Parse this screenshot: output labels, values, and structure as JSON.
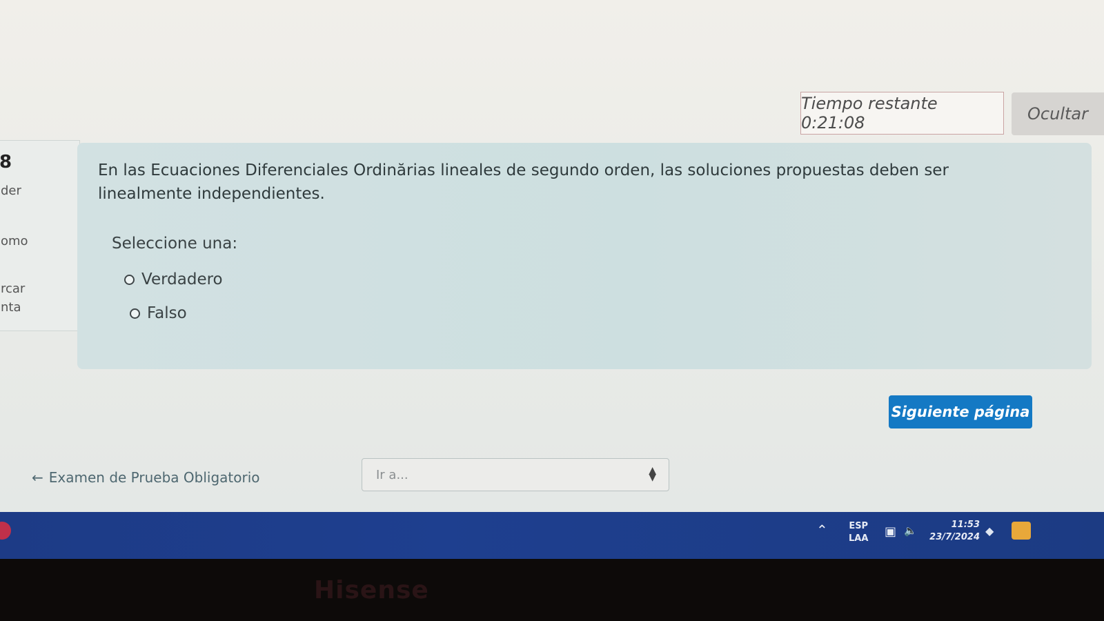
{
  "header": {
    "timer_text": "Tiempo restante 0:21:08",
    "hide_label": "Ocultar"
  },
  "info_panel": {
    "number": "8",
    "lines": [
      "der",
      "omo",
      "rcar",
      "nta"
    ]
  },
  "question": {
    "text": "En las Ecuaciones Diferenciales Ordinărias lineales de segundo orden, las soluciones propuestas deben ser linealmente independientes.",
    "prompt": "Seleccione una:",
    "options": [
      "Verdadero",
      "Falso"
    ]
  },
  "navigation": {
    "next_label": "Siguiente página",
    "back_link": "Examen de Prueba Obligatorio",
    "jump_placeholder": "Ir a..."
  },
  "taskbar": {
    "lang_top": "ESP",
    "lang_bottom": "LAA",
    "time": "11:53",
    "date": "23/7/2024"
  },
  "monitor": {
    "brand": "Hisense"
  },
  "colors": {
    "accent": "#1479c4",
    "taskbar": "#1e3f8f",
    "question_bg": "#cfe0e1"
  }
}
